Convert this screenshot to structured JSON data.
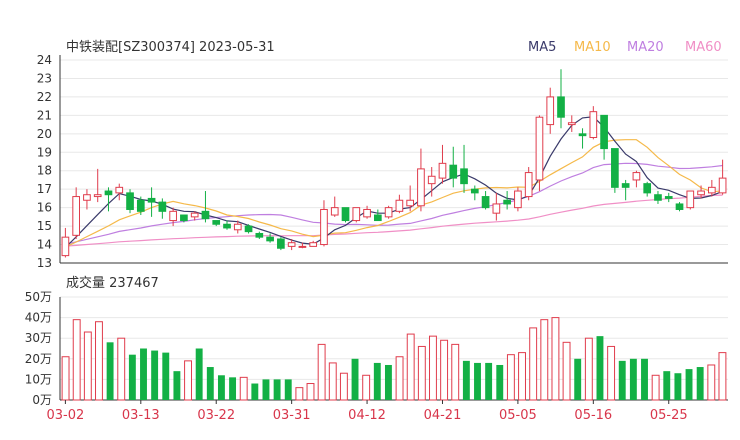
{
  "header": {
    "title": "中铁装配[SZ300374] 2023-05-31"
  },
  "legend": [
    {
      "label": "MA5",
      "color": "#3a3a6a"
    },
    {
      "label": "MA10",
      "color": "#f5b94a"
    },
    {
      "label": "MA20",
      "color": "#bf7fe0"
    },
    {
      "label": "MA60",
      "color": "#f08fc6"
    }
  ],
  "volume_header": {
    "label": "成交量 237467"
  },
  "colors": {
    "up": "#e03c4c",
    "down": "#13b045",
    "grid": "#e8e8e8",
    "axis": "#333333",
    "date": "#d8364b"
  },
  "chart_data": [
    {
      "type": "candlestick",
      "y_ticks": [
        13,
        14,
        15,
        16,
        17,
        18,
        19,
        20,
        21,
        22,
        23,
        24
      ],
      "ylim": [
        13,
        24
      ],
      "x_ticks": [
        {
          "label": "03-02",
          "index": 0
        },
        {
          "label": "03-13",
          "index": 7
        },
        {
          "label": "03-22",
          "index": 14
        },
        {
          "label": "03-31",
          "index": 21
        },
        {
          "label": "04-12",
          "index": 28
        },
        {
          "label": "04-21",
          "index": 35
        },
        {
          "label": "05-05",
          "index": 42
        },
        {
          "label": "05-16",
          "index": 49
        },
        {
          "label": "05-25",
          "index": 56
        }
      ],
      "candles": [
        [
          13.4,
          14.4,
          13.3,
          14.9
        ],
        [
          14.5,
          16.6,
          14.3,
          17.1
        ],
        [
          16.4,
          16.7,
          15.9,
          17.0
        ],
        [
          16.6,
          16.7,
          16.3,
          18.1
        ],
        [
          16.9,
          16.7,
          15.8,
          17.1
        ],
        [
          16.8,
          17.1,
          16.4,
          17.3
        ],
        [
          16.8,
          15.9,
          15.7,
          17.0
        ],
        [
          16.4,
          15.8,
          15.6,
          16.6
        ],
        [
          16.5,
          16.3,
          15.5,
          17.1
        ],
        [
          16.3,
          15.8,
          15.4,
          16.5
        ],
        [
          15.3,
          15.8,
          15.0,
          16.0
        ],
        [
          15.6,
          15.3,
          15.2,
          15.6
        ],
        [
          15.5,
          15.7,
          15.3,
          15.8
        ],
        [
          15.8,
          15.4,
          15.2,
          16.9
        ],
        [
          15.3,
          15.1,
          15.0,
          15.3
        ],
        [
          15.1,
          14.9,
          14.8,
          15.3
        ],
        [
          14.8,
          15.1,
          14.6,
          15.3
        ],
        [
          15.0,
          14.7,
          14.6,
          15.1
        ],
        [
          14.6,
          14.4,
          14.3,
          14.7
        ],
        [
          14.4,
          14.2,
          14.1,
          14.6
        ],
        [
          14.3,
          13.8,
          13.7,
          14.4
        ],
        [
          13.9,
          14.1,
          13.7,
          14.3
        ],
        [
          13.9,
          13.9,
          13.8,
          14.1
        ],
        [
          13.9,
          14.1,
          13.9,
          14.2
        ],
        [
          14.0,
          15.9,
          13.9,
          16.4
        ],
        [
          15.6,
          16.0,
          15.5,
          16.6
        ],
        [
          16.0,
          15.3,
          15.2,
          16.0
        ],
        [
          15.3,
          16.0,
          15.2,
          16.0
        ],
        [
          15.5,
          15.9,
          15.4,
          16.1
        ],
        [
          15.6,
          15.3,
          15.3,
          15.9
        ],
        [
          15.5,
          16.0,
          15.4,
          16.1
        ],
        [
          15.8,
          16.4,
          15.7,
          16.7
        ],
        [
          16.1,
          16.4,
          15.8,
          17.2
        ],
        [
          16.1,
          18.1,
          15.8,
          19.2
        ],
        [
          17.3,
          17.7,
          16.6,
          18.2
        ],
        [
          17.6,
          18.4,
          17.3,
          19.4
        ],
        [
          18.3,
          17.6,
          17.1,
          19.3
        ],
        [
          18.1,
          17.3,
          16.8,
          19.4
        ],
        [
          17.0,
          16.8,
          16.4,
          17.2
        ],
        [
          16.6,
          16.0,
          15.9,
          16.9
        ],
        [
          15.7,
          16.2,
          15.3,
          16.8
        ],
        [
          16.4,
          16.2,
          15.9,
          16.9
        ],
        [
          16.0,
          16.9,
          15.8,
          17.1
        ],
        [
          16.6,
          17.9,
          16.4,
          18.2
        ],
        [
          17.5,
          20.9,
          16.9,
          21.0
        ],
        [
          20.5,
          22.0,
          20.0,
          22.5
        ],
        [
          22.0,
          20.9,
          20.3,
          23.5
        ],
        [
          20.5,
          20.6,
          20.1,
          21.0
        ],
        [
          20.0,
          19.9,
          19.2,
          20.3
        ],
        [
          19.8,
          21.2,
          19.7,
          21.5
        ],
        [
          21.0,
          19.2,
          18.6,
          21.0
        ],
        [
          19.2,
          17.1,
          16.8,
          19.2
        ],
        [
          17.3,
          17.1,
          16.4,
          17.5
        ],
        [
          17.5,
          17.9,
          17.1,
          18.0
        ],
        [
          17.3,
          16.8,
          16.6,
          17.4
        ],
        [
          16.7,
          16.4,
          16.2,
          16.9
        ],
        [
          16.6,
          16.5,
          16.3,
          16.8
        ],
        [
          16.2,
          15.9,
          15.8,
          16.3
        ],
        [
          16.0,
          16.9,
          15.9,
          16.9
        ],
        [
          16.7,
          16.9,
          16.5,
          17.2
        ],
        [
          16.8,
          17.1,
          16.6,
          17.5
        ],
        [
          16.8,
          17.6,
          16.7,
          18.6
        ]
      ]
    },
    {
      "type": "bar",
      "y_ticks": [
        "0万",
        "10万",
        "20万",
        "30万",
        "40万",
        "50万"
      ],
      "ylim": [
        0,
        50
      ],
      "unit": "万",
      "volumes": [
        21,
        39,
        33,
        38,
        28,
        30,
        22,
        25,
        24,
        23,
        14,
        19,
        25,
        16,
        12,
        11,
        11,
        8,
        10,
        10,
        10,
        6,
        8,
        27,
        18,
        13,
        20,
        12,
        18,
        17,
        21,
        32,
        26,
        31,
        29,
        27,
        19,
        18,
        18,
        17,
        22,
        23,
        35,
        39,
        40,
        28,
        20,
        30,
        31,
        26,
        19,
        20,
        20,
        12,
        14,
        13,
        15,
        16,
        17,
        23
      ],
      "up": [
        1,
        1,
        1,
        1,
        0,
        1,
        0,
        0,
        0,
        0,
        0,
        1,
        0,
        0,
        0,
        0,
        1,
        0,
        0,
        0,
        0,
        1,
        1,
        1,
        1,
        1,
        0,
        1,
        0,
        0,
        1,
        1,
        1,
        1,
        1,
        1,
        0,
        0,
        0,
        0,
        1,
        1,
        1,
        1,
        1,
        1,
        0,
        1,
        0,
        1,
        0,
        0,
        0,
        1,
        0,
        0,
        0,
        0,
        1,
        1
      ]
    }
  ]
}
